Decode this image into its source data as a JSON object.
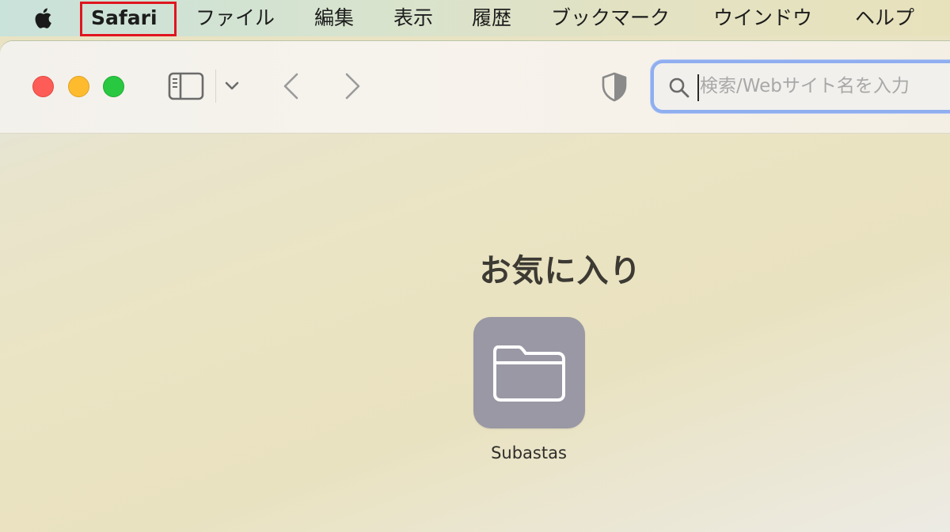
{
  "menubar": {
    "apple_icon": "apple-logo-icon",
    "items": [
      {
        "label": "Safari"
      },
      {
        "label": "ファイル"
      },
      {
        "label": "編集"
      },
      {
        "label": "表示"
      },
      {
        "label": "履歴"
      },
      {
        "label": "ブックマーク"
      },
      {
        "label": "ウインドウ"
      },
      {
        "label": "ヘルプ"
      }
    ],
    "highlight_color": "#e0151f"
  },
  "toolbar": {
    "traffic_lights": {
      "close": "#fd5d56",
      "minimize": "#febb2e",
      "zoom": "#28c840"
    },
    "icons": [
      "sidebar-icon",
      "chevron-down-icon",
      "chevron-left-icon",
      "chevron-right-icon",
      "privacy-shield-icon",
      "search-icon"
    ],
    "search": {
      "placeholder": "検索/Webサイト名を入力",
      "focus_color": "#8eaef0"
    }
  },
  "content": {
    "favorites_title": "お気に入り",
    "favorites": [
      {
        "label": "Subastas",
        "icon": "folder-icon",
        "tile_color": "#9998a4"
      }
    ]
  }
}
